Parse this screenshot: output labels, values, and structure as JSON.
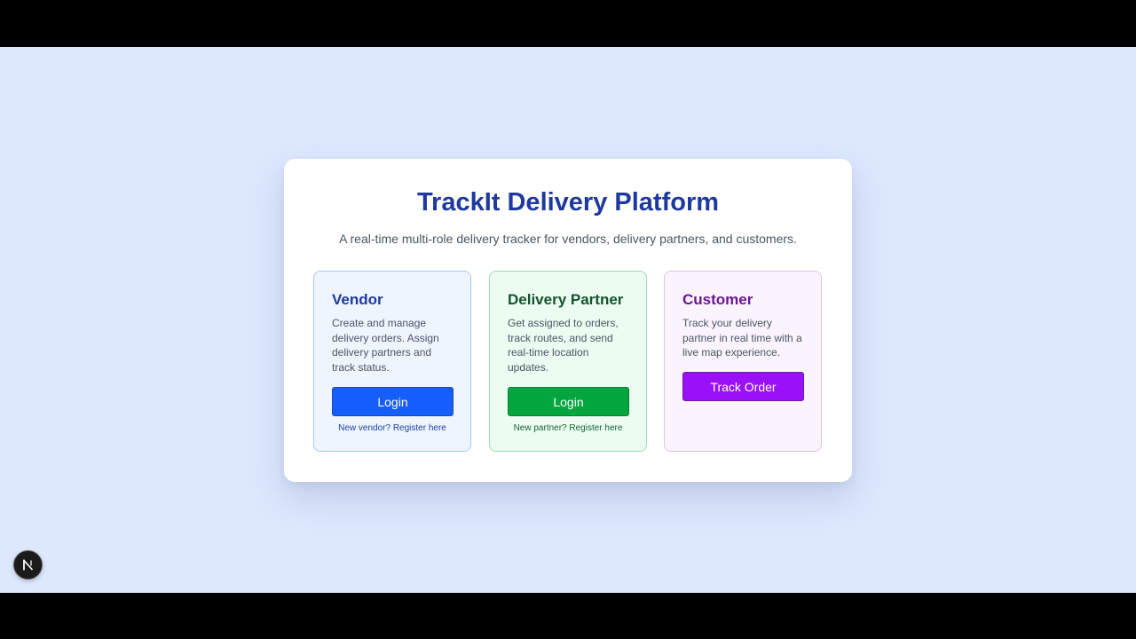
{
  "header": {
    "title": "TrackIt Delivery Platform",
    "subtitle": "A real-time multi-role delivery tracker for vendors, delivery partners, and customers."
  },
  "roles": {
    "vendor": {
      "title": "Vendor",
      "description": "Create and manage delivery orders. Assign delivery partners and track status.",
      "button_label": "Login",
      "link_text": "New vendor? Register here"
    },
    "partner": {
      "title": "Delivery Partner",
      "description": "Get assigned to orders, track routes, and send real-time location updates.",
      "button_label": "Login",
      "link_text": "New partner? Register here"
    },
    "customer": {
      "title": "Customer",
      "description": "Track your delivery partner in real time with a live map experience.",
      "button_label": "Track Order"
    }
  },
  "devtools": {
    "icon": "nextjs-logo-icon"
  },
  "colors": {
    "page_background": "#dde8fd",
    "title": "#1e3a9e",
    "vendor_button": "#165efb",
    "partner_button": "#03a53f",
    "customer_button": "#9a10f8"
  }
}
